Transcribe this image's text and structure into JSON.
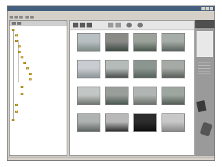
{
  "window": {
    "title": ""
  },
  "menu": [
    "",
    "",
    "",
    "",
    "",
    "",
    ""
  ],
  "tree": [
    {
      "label": ""
    },
    {
      "label": ""
    },
    {
      "label": ""
    },
    {
      "label": ""
    },
    {
      "label": ""
    },
    {
      "label": ""
    },
    {
      "label": ""
    },
    {
      "label": ""
    },
    {
      "label": ""
    },
    {
      "label": ""
    },
    {
      "label": ""
    },
    {
      "label": ""
    },
    {
      "label": ""
    },
    {
      "label": ""
    },
    {
      "label": ""
    }
  ],
  "thumbnails": [
    {
      "caption": "",
      "colors": [
        "#b9c0c4",
        "#7d8a86"
      ]
    },
    {
      "caption": "",
      "colors": [
        "#8a8a86",
        "#3f4a44"
      ]
    },
    {
      "caption": "",
      "colors": [
        "#9aa29a",
        "#4d5a50"
      ]
    },
    {
      "caption": "",
      "colors": [
        "#a6aca8",
        "#5b6560"
      ]
    },
    {
      "caption": "",
      "colors": [
        "#c9cdd1",
        "#8d969a"
      ]
    },
    {
      "caption": "",
      "colors": [
        "#b5bbb8",
        "#4a4f4c"
      ]
    },
    {
      "caption": "",
      "colors": [
        "#8c9690",
        "#55605a"
      ]
    },
    {
      "caption": "",
      "colors": [
        "#a5aaa6",
        "#575d58"
      ]
    },
    {
      "caption": "",
      "colors": [
        "#c2c6c4",
        "#6e7571"
      ]
    },
    {
      "caption": "",
      "colors": [
        "#999e9a",
        "#4a5750"
      ]
    },
    {
      "caption": "",
      "colors": [
        "#b0b4b2",
        "#6a706c"
      ]
    },
    {
      "caption": "",
      "colors": [
        "#9ea6a0",
        "#545c56"
      ]
    },
    {
      "caption": "",
      "colors": [
        "#aeb2b1",
        "#5f6663"
      ]
    },
    {
      "caption": "",
      "colors": [
        "#b8b8b8",
        "#303030"
      ]
    },
    {
      "caption": "",
      "colors": [
        "#2c2c2c",
        "#0e0e0e"
      ]
    },
    {
      "caption": "",
      "colors": [
        "#c8c8c8",
        "#8a8a8a"
      ]
    }
  ],
  "status": {
    "text": ""
  },
  "colors": {
    "titlebar": "#45607e",
    "chrome": "#d4d0c8",
    "selection": "#24467a",
    "sidepanel": "#9a9a9a"
  }
}
